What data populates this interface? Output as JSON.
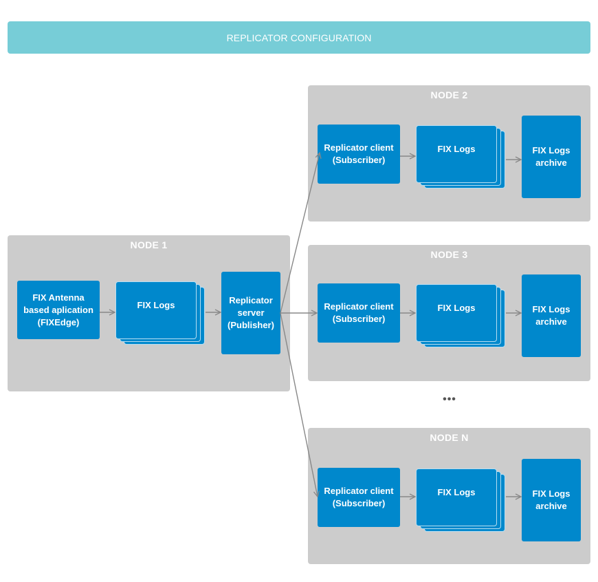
{
  "banner": {
    "title": "REPLICATOR CONFIGURATION"
  },
  "colors": {
    "banner": "#77cdd7",
    "node_bg": "#cccccc",
    "box": "#0088cc",
    "arrow": "#888888"
  },
  "node1": {
    "title": "NODE 1",
    "app": "FIX Antenna based aplication (FIXEdge)",
    "app_lines": [
      "FIX Antenna",
      "based aplication",
      "(FIXEdge)"
    ],
    "logs": "FIX Logs",
    "server_lines": [
      "Replicator",
      "server",
      "(Publisher)"
    ]
  },
  "subscriber_nodes": [
    {
      "title": "NODE 2",
      "client_lines": [
        "Replicator client",
        "(Subscriber)"
      ],
      "logs": "FIX Logs",
      "archive_lines": [
        "FIX Logs",
        "archive"
      ]
    },
    {
      "title": "NODE 3",
      "client_lines": [
        "Replicator client",
        "(Subscriber)"
      ],
      "logs": "FIX Logs",
      "archive_lines": [
        "FIX Logs",
        "archive"
      ]
    },
    {
      "title": "NODE N",
      "client_lines": [
        "Replicator client",
        "(Subscriber)"
      ],
      "logs": "FIX Logs",
      "archive_lines": [
        "FIX Logs",
        "archive"
      ]
    }
  ],
  "ellipsis": "•••"
}
